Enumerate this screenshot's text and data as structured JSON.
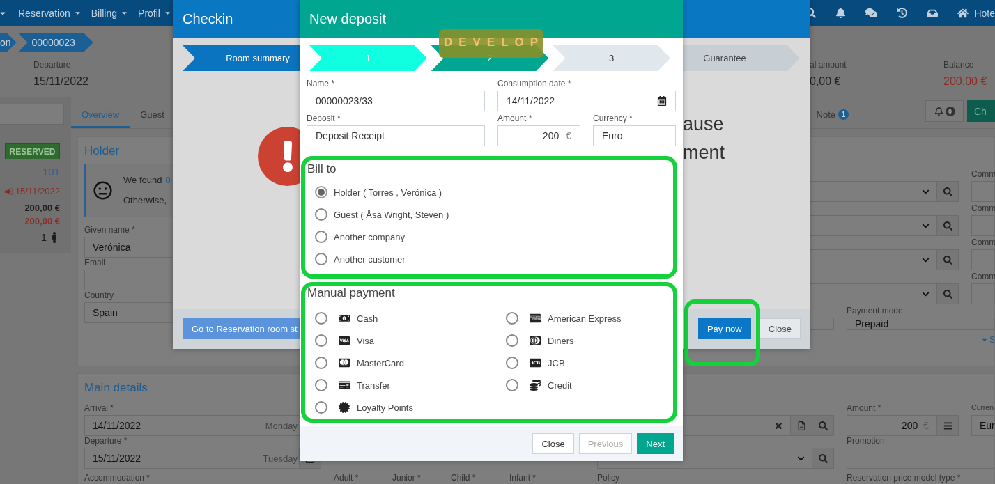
{
  "nav": {
    "menus": [
      {
        "label": "Reservation"
      },
      {
        "label": "Billing"
      },
      {
        "label": "Profil"
      }
    ],
    "home_label": "Hote"
  },
  "breadcrumb": [
    {
      "label": "on"
    },
    {
      "label": "00000023"
    }
  ],
  "summary": [
    {
      "label": "Departure",
      "value": "15/11/2022",
      "negative": false
    },
    {
      "label": "al amount",
      "value": "0,00 €",
      "negative": false
    },
    {
      "label": "Balance",
      "value": "200,00 €",
      "negative": true
    }
  ],
  "sidebar": {
    "status": "RESERVED",
    "room": "101",
    "departure": "15/11/2022",
    "total": "200,00 €",
    "balance": "200,00 €",
    "guests": "1"
  },
  "tabs": [
    {
      "label": "Overview",
      "selected": true
    },
    {
      "label": "Guest",
      "selected": false
    },
    {
      "label": "Note",
      "selected": false,
      "count": "1"
    }
  ],
  "alerts": {
    "count": "0"
  },
  "checkin_button": {
    "label": "Ch"
  },
  "holder": {
    "title": "Holder",
    "notice_lines": [
      {
        "text": "We found",
        "link": "0"
      },
      {
        "text": "Otherwise,"
      }
    ],
    "fields": [
      {
        "label": "Given name *",
        "value": "Verónica"
      },
      {
        "label": "Email"
      },
      {
        "label": "Country",
        "value": "Spain"
      }
    ]
  },
  "side_fields": {
    "comm_labels": [
      "Comm",
      "Comm",
      "Comm",
      "Comm"
    ],
    "payment_mode": {
      "label": "Payment mode",
      "value": "Prepaid"
    },
    "more_link": "S"
  },
  "main_details": {
    "title": "Main details",
    "dates": [
      {
        "label": "Arrival *",
        "value": "14/11/2022",
        "day": "Monday"
      },
      {
        "label": "Departure *",
        "value": "15/11/2022",
        "day": "Tuesday"
      }
    ],
    "amount": {
      "label": "Amount *",
      "value": "200",
      "unit": "€"
    },
    "currency": {
      "label": "Curren",
      "value": "Eur"
    },
    "promotion": {
      "label": "Promotion"
    },
    "accommodation": "Accommodation *",
    "occupancy": [
      "Adult *",
      "Junior *",
      "Child *",
      "Infant *"
    ],
    "policy": "Policy",
    "price_model": "Reservation price model type *"
  },
  "checkin_dialog": {
    "title": "Checkin",
    "steps": [
      {
        "label": "Room summary",
        "selected": true
      },
      {
        "label": "Guarantee",
        "selected": false
      }
    ],
    "message_fragments": [
      "ause",
      "ment"
    ],
    "footer_link": "Go to Reservation room st",
    "pay_now": {
      "label": "Pay now",
      "highlighted": true
    },
    "close": "Close"
  },
  "deposit_dialog": {
    "title": "New deposit",
    "env_badge": "DEVELOP",
    "steps": [
      {
        "label": "1",
        "done": true,
        "selected": false
      },
      {
        "label": "2",
        "done": false,
        "selected": true
      },
      {
        "label": "3",
        "done": false,
        "selected": false
      }
    ],
    "name": {
      "label": "Name *",
      "value": "00000023/33"
    },
    "consumption_date": {
      "label": "Consumption date *",
      "value": "14/11/2022"
    },
    "deposit": {
      "label": "Deposit *",
      "value": "Deposit Receipt"
    },
    "amount": {
      "label": "Amount *",
      "value": "200",
      "unit": "€"
    },
    "currency": {
      "label": "Currency *",
      "value": "Euro"
    },
    "bill_to": {
      "title": "Bill to",
      "highlighted": true,
      "options": [
        {
          "label": "Holder ( Torres , Verónica )",
          "selected": true
        },
        {
          "label": "Guest ( Åsa Wright, Steven )",
          "selected": false
        },
        {
          "label": "Another company",
          "selected": false
        },
        {
          "label": "Another customer",
          "selected": false
        }
      ]
    },
    "manual_payment": {
      "title": "Manual payment",
      "highlighted": true,
      "methods": [
        {
          "label": "Cash",
          "selected": false
        },
        {
          "label": "American Express",
          "selected": false
        },
        {
          "label": "Visa",
          "selected": false
        },
        {
          "label": "Diners",
          "selected": false
        },
        {
          "label": "MasterCard",
          "selected": false
        },
        {
          "label": "JCB",
          "selected": false
        },
        {
          "label": "Transfer",
          "selected": false
        },
        {
          "label": "Credit",
          "selected": false
        },
        {
          "label": "Loyalty Points",
          "selected": false
        }
      ]
    },
    "buttons": [
      {
        "label": "Close",
        "kind": "default",
        "disabled": false
      },
      {
        "label": "Previous",
        "kind": "default",
        "disabled": true
      },
      {
        "label": "Next",
        "kind": "primary",
        "disabled": false
      }
    ]
  }
}
